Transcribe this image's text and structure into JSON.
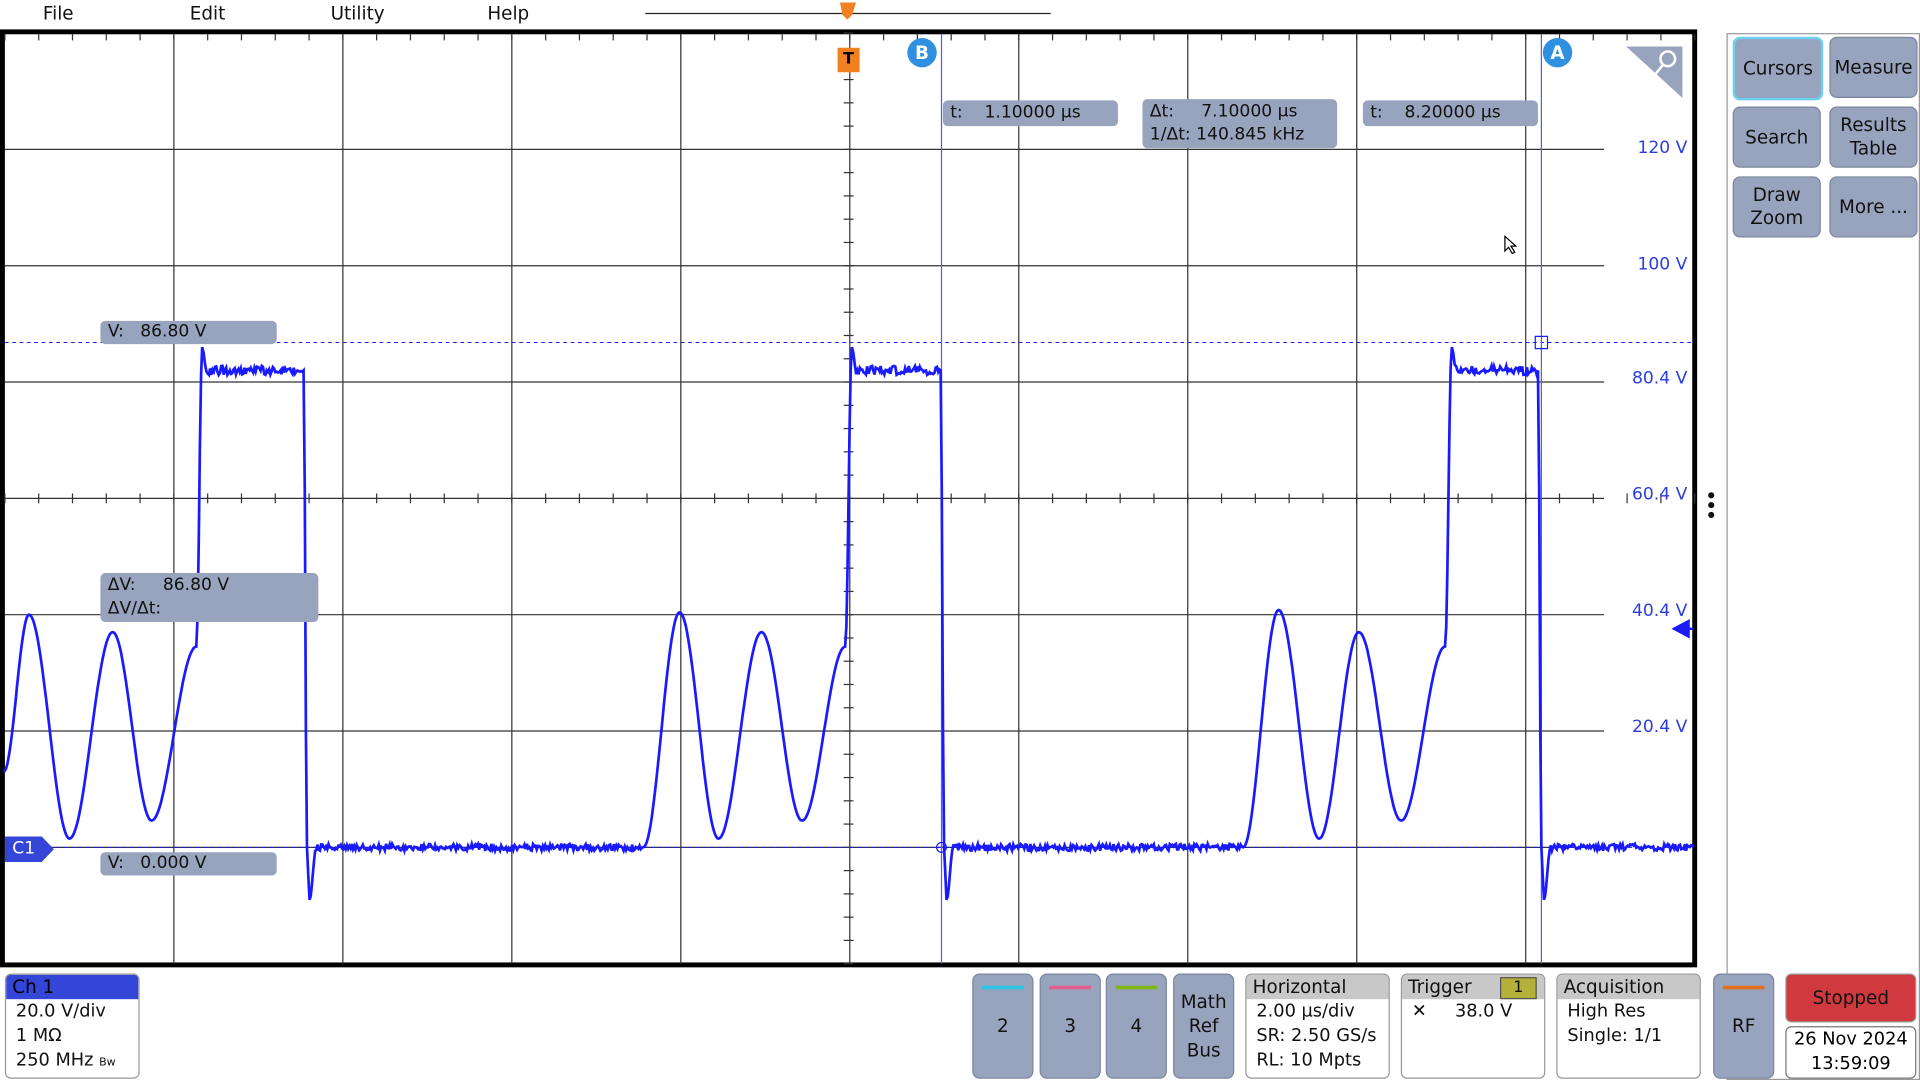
{
  "menu": [
    "File",
    "Edit",
    "Utility",
    "Help"
  ],
  "colors": {
    "channel1": "#1a1aff",
    "grid": "#2a2a2a",
    "readout": "#98a4be",
    "stopped": "#d0393e",
    "ch2": "#2fc6e6",
    "ch3": "#e0608e",
    "ch4": "#7fb61a",
    "rf": "#e07020",
    "trigger_badge": "#b5b03a"
  },
  "trigger_marker": "T",
  "cursors": {
    "b_label": "B",
    "a_label": "A",
    "b_time": "t:    1.10000 µs",
    "delta_t": "Δt:     7.10000 µs",
    "inv_delta_t": "1/Δt: 140.845 kHz",
    "a_time": "t:    8.20000 µs",
    "v_top": "V:   86.80 V",
    "delta_v": "ΔV:     86.80 V",
    "dv_dt": "ΔV/Δt:",
    "v_bottom": "V:   0.000 V",
    "b_t_us": 1.1,
    "a_t_us": 8.2,
    "v_a": 86.8,
    "v_b": 0.0
  },
  "volt_labels": [
    "120 V",
    "100 V",
    "80.4 V",
    "60.4 V",
    "40.4 V",
    "20.4 V"
  ],
  "volt_values": [
    120,
    100,
    80.4,
    60.4,
    40.4,
    20.4
  ],
  "channel_marker": "C1",
  "trigger_level_v": 38.0,
  "waveform": {
    "time_per_div_us": 2.0,
    "volts_per_div": 20.0,
    "points": [
      [
        -10,
        13
      ],
      [
        -9.7,
        40
      ],
      [
        -9.22,
        1.5
      ],
      [
        -8.71,
        37
      ],
      [
        -8.25,
        4.6
      ],
      [
        -7.72,
        34.5
      ],
      [
        -7.65,
        86
      ],
      [
        -7.6,
        82
      ],
      [
        -6.45,
        82
      ],
      [
        -6.41,
        0
      ],
      [
        -6.38,
        -9
      ],
      [
        -6.3,
        0
      ],
      [
        -2.43,
        0
      ],
      [
        -2.0,
        40.4
      ],
      [
        -1.54,
        1.5
      ],
      [
        -1.03,
        37
      ],
      [
        -0.55,
        4.6
      ],
      [
        -0.04,
        34.5
      ],
      [
        0.04,
        86
      ],
      [
        0.09,
        82
      ],
      [
        1.09,
        82
      ],
      [
        1.13,
        0
      ],
      [
        1.16,
        -9
      ],
      [
        1.24,
        0
      ],
      [
        4.67,
        0
      ],
      [
        5.09,
        40.8
      ],
      [
        5.57,
        1.5
      ],
      [
        6.04,
        37
      ],
      [
        6.54,
        4.6
      ],
      [
        7.06,
        34.5
      ],
      [
        7.14,
        86
      ],
      [
        7.19,
        82
      ],
      [
        8.16,
        82
      ],
      [
        8.2,
        0
      ],
      [
        8.23,
        -9
      ],
      [
        8.31,
        0
      ],
      [
        10,
        0
      ]
    ]
  },
  "right_panel": {
    "buttons": [
      "Cursors",
      "Measure",
      "Search",
      "Results\nTable",
      "Draw\nZoom",
      "More ..."
    ]
  },
  "bottom": {
    "ch1": {
      "title": "Ch 1",
      "lines": [
        "20.0 V/div",
        "1 MΩ",
        "250 MHz"
      ],
      "bw": "Bw"
    },
    "ch_buttons": [
      "2",
      "3",
      "4"
    ],
    "math_ref_bus": "Math\nRef\nBus",
    "horizontal": {
      "title": "Horizontal",
      "lines": [
        "2.00 µs/div",
        "SR: 2.50 GS/s",
        "RL: 10 Mpts"
      ]
    },
    "trigger": {
      "title": "Trigger",
      "source": "1",
      "level": "38.0 V"
    },
    "acquisition": {
      "title": "Acquisition",
      "lines": [
        "High Res",
        "Single: 1/1"
      ]
    },
    "rf": "RF",
    "status": "Stopped",
    "date": "26 Nov 2024",
    "time": "13:59:09"
  }
}
